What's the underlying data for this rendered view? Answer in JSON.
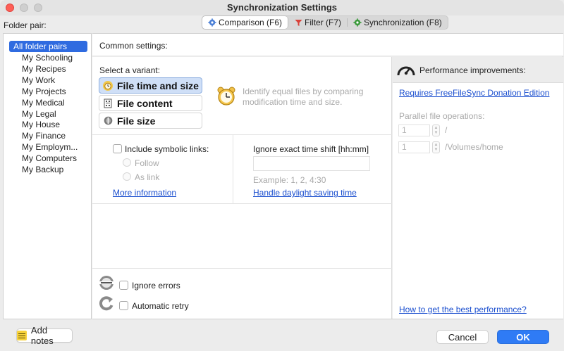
{
  "window": {
    "title": "Synchronization Settings"
  },
  "tabs": [
    {
      "label": "Comparison (F6)",
      "icon": "gear-icon",
      "active": true
    },
    {
      "label": "Filter (F7)",
      "icon": "funnel-icon",
      "active": false
    },
    {
      "label": "Synchronization (F8)",
      "icon": "sync-gear-icon",
      "active": false
    }
  ],
  "sidebar": {
    "label": "Folder pair:",
    "items": [
      {
        "label": "All folder pairs",
        "selected": true
      },
      {
        "label": "My Schooling"
      },
      {
        "label": "My Recipes"
      },
      {
        "label": "My Work"
      },
      {
        "label": "My Projects"
      },
      {
        "label": "My Medical"
      },
      {
        "label": "My Legal"
      },
      {
        "label": "My House"
      },
      {
        "label": "My Finance"
      },
      {
        "label": "My Employm..."
      },
      {
        "label": "My Computers"
      },
      {
        "label": "My Backup"
      }
    ]
  },
  "common": {
    "label": "Common settings:",
    "variant_label": "Select a variant:",
    "variants": [
      {
        "label": "File time and size",
        "icon": "clock-icon",
        "active": true
      },
      {
        "label": "File content",
        "icon": "document-icon",
        "active": false
      },
      {
        "label": "File size",
        "icon": "disk-icon",
        "active": false
      }
    ],
    "description": "Identify equal files by comparing modification time and size.",
    "symlinks": {
      "label": "Include symbolic links:",
      "follow": "Follow",
      "as_link": "As link",
      "more_info": "More information"
    },
    "timeshift": {
      "label": "Ignore exact time shift [hh:mm]",
      "value": "",
      "example": "Example:  1, 2, 4:30",
      "daylight_link": "Handle daylight saving time"
    },
    "ignore_errors": "Ignore errors",
    "automatic_retry": "Automatic retry"
  },
  "performance": {
    "title": "Performance improvements:",
    "donation_link": "Requires FreeFileSync Donation Edition",
    "parallel_label": "Parallel file operations:",
    "rows": [
      {
        "value": "1",
        "path": "/"
      },
      {
        "value": "1",
        "path": "/Volumes/home"
      }
    ],
    "best_link": "How to get the best performance?"
  },
  "footer": {
    "add_notes": "Add notes",
    "cancel": "Cancel",
    "ok": "OK"
  },
  "colors": {
    "accent": "#2f7bf5",
    "selection": "#2f6be0",
    "link": "#1b4fcf"
  }
}
